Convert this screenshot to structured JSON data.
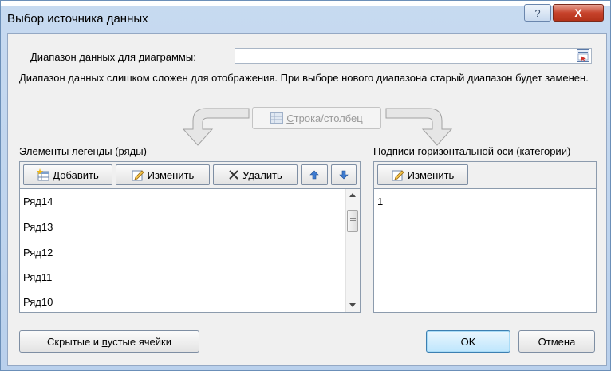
{
  "window": {
    "title": "Выбор источника данных",
    "help_label": "?",
    "close_label": "X"
  },
  "range": {
    "label": "Диапазон данных для диаграммы:",
    "value": ""
  },
  "info_text": "Диапазон данных слишком сложен для отображения. При выборе нового диапазона старый диапазон будет заменен.",
  "switch_button": {
    "label_underlined": "С",
    "label_rest": "трока/столбец"
  },
  "legend": {
    "title": "Элементы легенды (ряды)",
    "add": {
      "pre": "До",
      "u": "б",
      "post": "авить"
    },
    "edit": {
      "pre": "",
      "u": "И",
      "post": "зменить"
    },
    "delete": {
      "pre": "",
      "u": "У",
      "post": "далить"
    },
    "items": [
      "Ряд14",
      "Ряд13",
      "Ряд12",
      "Ряд11",
      "Ряд10"
    ]
  },
  "axis": {
    "title": "Подписи горизонтальной оси (категории)",
    "edit": {
      "pre": "Изме",
      "u": "н",
      "post": "ить"
    },
    "items": [
      "1"
    ]
  },
  "buttons": {
    "hidden": {
      "pre": "Скрытые и ",
      "u": "п",
      "post": "устые ячейки"
    },
    "ok": "OK",
    "cancel": "Отмена"
  },
  "colors": {
    "accent": "#3c7fb1",
    "close": "#c7432c"
  }
}
